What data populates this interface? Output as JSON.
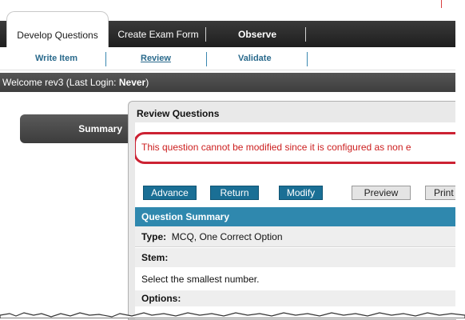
{
  "tabs": [
    {
      "label": "Develop Questions",
      "active": true
    },
    {
      "label": "Create Exam Form",
      "active": false
    },
    {
      "label": "Observe",
      "active": false
    }
  ],
  "subnav": [
    {
      "label": "Write Item",
      "active": false
    },
    {
      "label": "Review",
      "active": true
    },
    {
      "label": "Validate",
      "active": false
    }
  ],
  "welcome": {
    "prefix": "Welcome rev3 (Last Login: ",
    "last_login": "Never",
    "suffix": ")"
  },
  "sidebar": {
    "summary_label": "Summary"
  },
  "panel": {
    "title": "Review Questions",
    "error_message": "This question cannot be modified since it is configured as non e",
    "buttons": {
      "advance": "Advance",
      "return": "Return",
      "modify": "Modify",
      "preview": "Preview",
      "print": "Print"
    },
    "summary_header": "Question Summary",
    "type_label": "Type:",
    "type_value": "MCQ, One Correct Option",
    "stem_label": "Stem:",
    "stem_text": "Select the smallest number.",
    "options_label": "Options:"
  },
  "colors": {
    "accent": "#2f88ae",
    "button": "#1a6f95",
    "error": "#cc1f1f",
    "highlight_ring": "#cc2233"
  }
}
